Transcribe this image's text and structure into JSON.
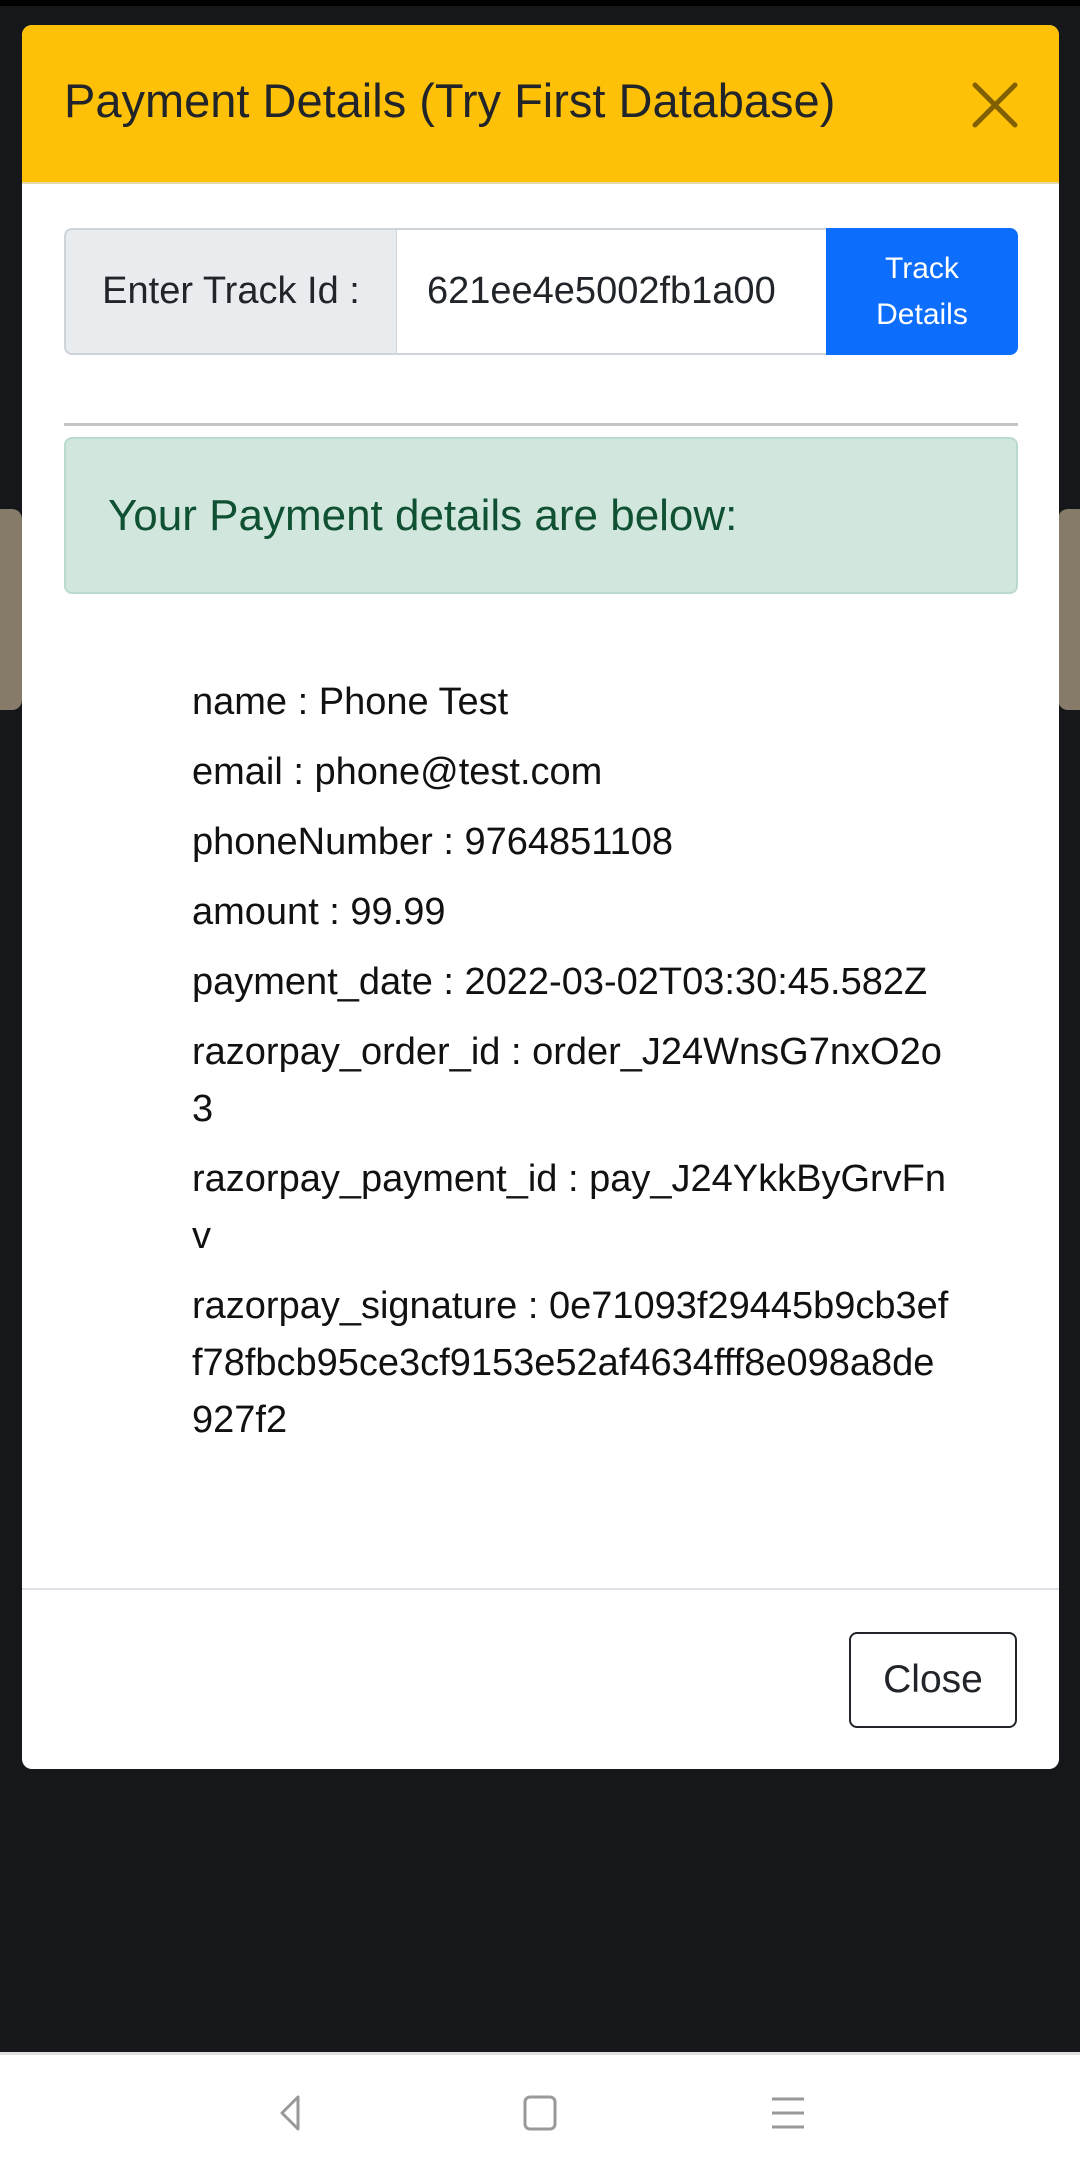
{
  "modal": {
    "title": "Payment Details (Try First Database)",
    "header_color": "#ffc107",
    "close_icon": "close-icon"
  },
  "track_form": {
    "label": "Enter Track Id :",
    "input_value": "621ee4e5002fb1a00",
    "button_label_line1": "Track",
    "button_label_line2": "Details",
    "button_color": "#0d6efd"
  },
  "alert": {
    "text": "Your Payment details are below:",
    "bg_color": "#d1e7dd",
    "text_color": "#0f5132"
  },
  "details": [
    {
      "key": "name",
      "value": "Phone Test"
    },
    {
      "key": "email",
      "value": "phone@test.com"
    },
    {
      "key": "phoneNumber",
      "value": "9764851108"
    },
    {
      "key": "amount",
      "value": "99.99"
    },
    {
      "key": "payment_date",
      "value": "2022-03-02T03:30:45.582Z"
    },
    {
      "key": "razorpay_order_id",
      "value": "order_J24WnsG7nxO2o3"
    },
    {
      "key": "razorpay_payment_id",
      "value": "pay_J24YkkByGrvFnv"
    },
    {
      "key": "razorpay_signature",
      "value": "0e71093f29445b9cb3eff78fbcb95ce3cf9153e52af4634fff8e098a8de927f2"
    }
  ],
  "footer": {
    "close_label": "Close"
  },
  "system_nav": {
    "back_icon": "back-icon",
    "home_icon": "home-icon",
    "menu_icon": "menu-icon"
  }
}
